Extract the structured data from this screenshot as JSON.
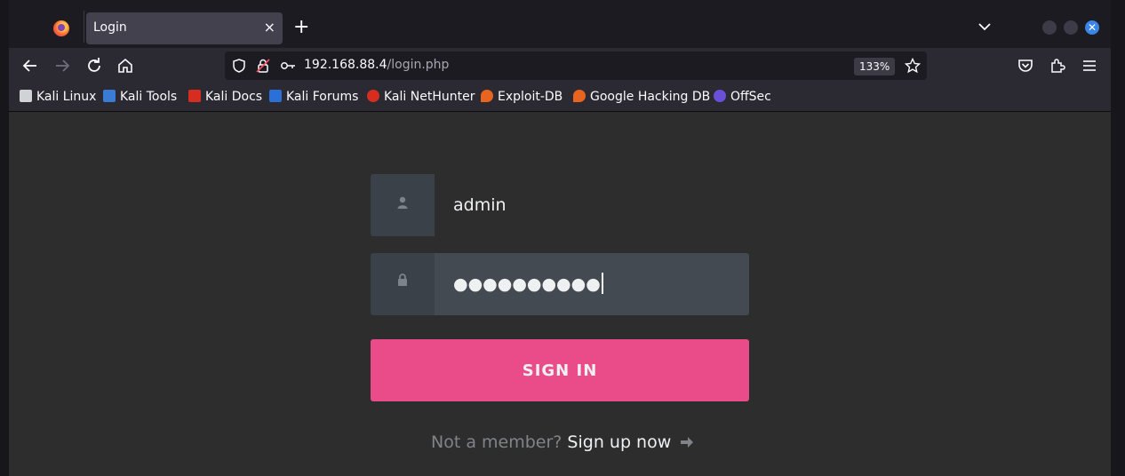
{
  "browser": {
    "tab": {
      "title": "Login",
      "close": "×"
    },
    "new_tab": "+",
    "url": {
      "host": "192.168.88.4",
      "path": "/login.php"
    },
    "zoom": "133%",
    "close_symbol": "✕"
  },
  "bookmarks": [
    {
      "label": "Kali Linux",
      "color": "#cfd3d6"
    },
    {
      "label": "Kali Tools",
      "color": "#3a7bd5"
    },
    {
      "label": "Kali Docs",
      "color": "#d62d20"
    },
    {
      "label": "Kali Forums",
      "color": "#2b6fd8"
    },
    {
      "label": "Kali NetHunter",
      "color": "#d62d20"
    },
    {
      "label": "Exploit-DB",
      "color": "#e8641f"
    },
    {
      "label": "Google Hacking DB",
      "color": "#e8641f"
    },
    {
      "label": "OffSec",
      "color": "#6b4fd8"
    }
  ],
  "login": {
    "username": "admin",
    "password_mask": "●●●●●●●●●●",
    "signin_label": "SIGN IN",
    "not_member": "Not a member?",
    "signup_link": "Sign up now"
  },
  "colors": {
    "accent": "#ea4c89",
    "page_bg": "#2d2d2d",
    "icon_box": "#3b4148"
  }
}
